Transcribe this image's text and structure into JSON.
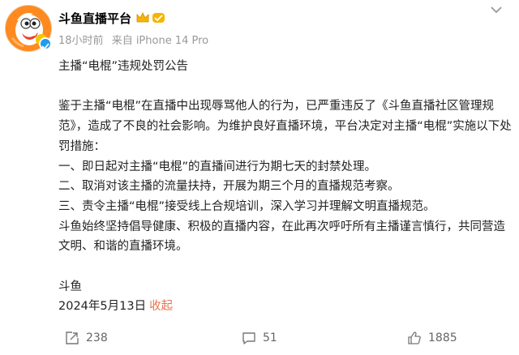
{
  "account": {
    "name": "斗鱼直播平台",
    "time": "18小时前",
    "source": "来自 iPhone 14 Pro"
  },
  "post": {
    "title": "主播“电棍”违规处罚公告",
    "para1": "鉴于主播“电棍”在直播中出现辱骂他人的行为，已严重违反了《斗鱼直播社区管理规范》，造成了不良的社会影响。为维护良好直播环境，平台决定对主播“电棍”实施以下处罚措施：",
    "items": [
      "一、即日起对主播“电棍”的直播间进行为期七天的封禁处理。",
      "二、取消对该主播的流量扶持，开展为期三个月的直播规范考察。",
      "三、责令主播“电棍”接受线上合规培训，深入学习并理解文明直播规范。"
    ],
    "para2": "斗鱼始终坚持倡导健康、积极的直播内容，在此再次呼吁所有主播谨言慎行，共同营造文明、和谐的直播环境。",
    "signature": "斗鱼",
    "date": "2024年5月13日",
    "collapse": "收起"
  },
  "actions": {
    "repost_count": "238",
    "comment_count": "51",
    "like_count": "1885"
  },
  "colors": {
    "accent": "#eb7350",
    "muted": "#999999",
    "verify": "#1f9bf0",
    "avatar": "#ff8a1f"
  }
}
